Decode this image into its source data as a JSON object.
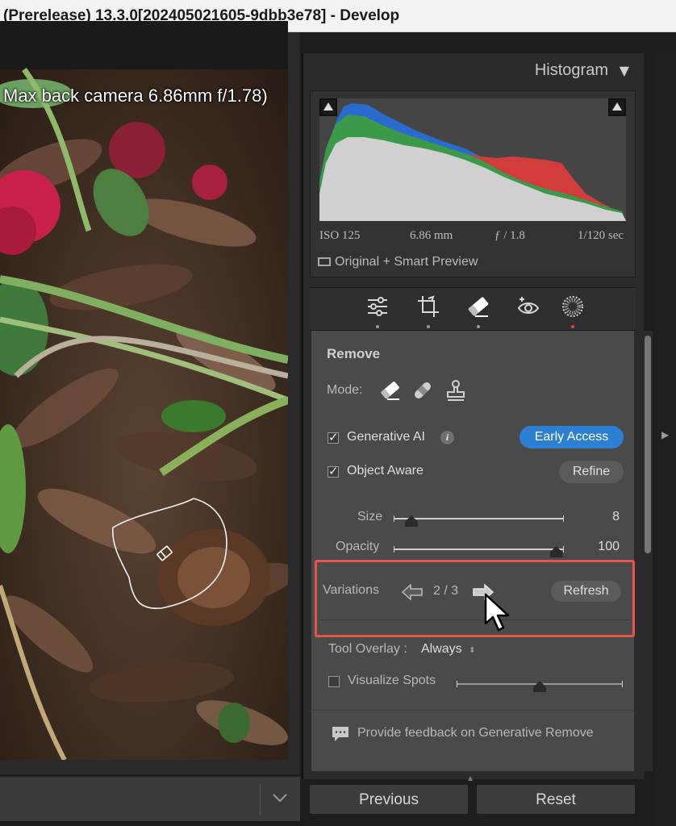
{
  "window": {
    "title": "(Prerelease) 13.3.0[202405021605-9dbb3e78] - Develop"
  },
  "photo": {
    "info_overlay": "Max back camera 6.86mm f/1.78)"
  },
  "histogram": {
    "title": "Histogram",
    "exif": {
      "iso": "ISO 125",
      "focal_length": "6.86 mm",
      "aperture": "ƒ / 1.8",
      "shutter": "1/120 sec"
    },
    "preview_status": "Original + Smart Preview"
  },
  "tools": {
    "items": [
      {
        "name": "edit-sliders-icon"
      },
      {
        "name": "crop-icon"
      },
      {
        "name": "remove-eraser-icon"
      },
      {
        "name": "red-eye-icon"
      },
      {
        "name": "masking-icon"
      }
    ],
    "active_index": 2,
    "dot_accent_color": "#e8402d"
  },
  "remove": {
    "title": "Remove",
    "mode_label": "Mode:",
    "generative_ai_label": "Generative AI",
    "generative_ai_checked": true,
    "early_access_label": "Early Access",
    "object_aware_label": "Object Aware",
    "object_aware_checked": true,
    "refine_label": "Refine",
    "size_label": "Size",
    "size_value": "8",
    "size_fraction": 0.08,
    "opacity_label": "Opacity",
    "opacity_value": "100",
    "opacity_fraction": 1.0,
    "variations_label": "Variations",
    "variations_counter": "2 / 3",
    "refresh_label": "Refresh",
    "tool_overlay_label": "Tool Overlay :",
    "tool_overlay_value": "Always",
    "visualize_spots_label": "Visualize Spots",
    "visualize_spots_checked": false,
    "visualize_fraction": 0.5,
    "feedback_label": "Provide feedback on Generative Remove"
  },
  "bottom": {
    "previous_label": "Previous",
    "reset_label": "Reset"
  },
  "colors": {
    "accent_blue": "#2d7fd4",
    "highlight_red": "#e8524a"
  }
}
